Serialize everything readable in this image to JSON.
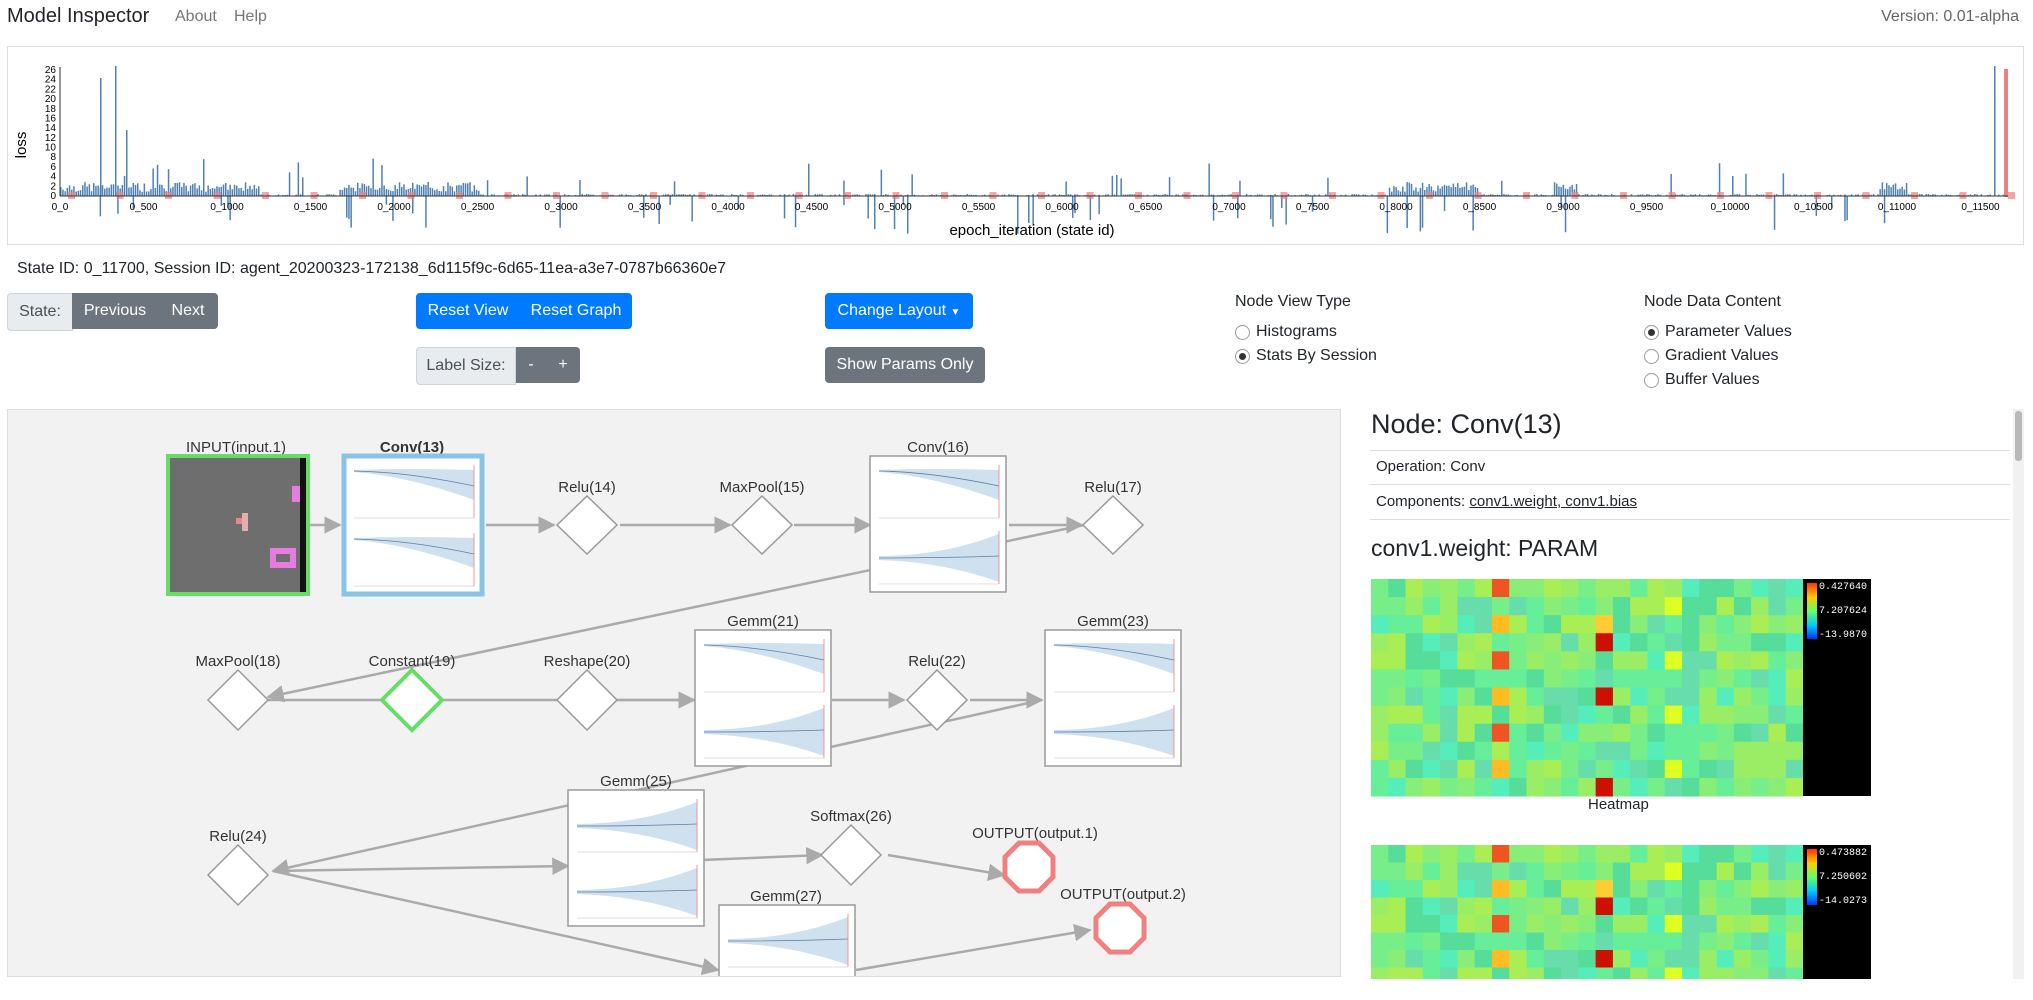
{
  "navbar": {
    "brand": "Model Inspector",
    "links": [
      "About",
      "Help"
    ],
    "version": "Version: 0.01-alpha"
  },
  "loss_chart": {
    "ylabel": "loss",
    "xlabel": "epoch_iteration (state id)",
    "y_ticks": [
      "26",
      "24",
      "22",
      "20",
      "18",
      "16",
      "14",
      "12",
      "10",
      "8",
      "6",
      "4",
      "2",
      "0"
    ],
    "x_ticks": [
      "0_0",
      "0_500",
      "0_1000",
      "0_1500",
      "0_2000",
      "0_2500",
      "0_3000",
      "0_3500",
      "0_4000",
      "0_4500",
      "0_5000",
      "0_5500",
      "0_6000",
      "0_6500",
      "0_7000",
      "0_7500",
      "0_8000",
      "0_8500",
      "0_9000",
      "0_9500",
      "0_10000",
      "0_10500",
      "0_11000",
      "0_11500"
    ],
    "bar_color": "#4f81b4",
    "marker_color": "#f08080"
  },
  "state_info": "State ID: 0_11700, Session ID: agent_20200323-172138_6d115f9c-6d65-11ea-a3e7-0787b66360e7",
  "controls": {
    "state_label": "State:",
    "previous": "Previous",
    "next": "Next",
    "reset_view": "Reset View",
    "reset_graph": "Reset Graph",
    "label_size": "Label Size:",
    "minus": "-",
    "plus": "+",
    "change_layout": "Change Layout",
    "show_params": "Show Params Only"
  },
  "node_view": {
    "title": "Node View Type",
    "options": [
      {
        "label": "Histograms",
        "selected": false
      },
      {
        "label": "Stats By Session",
        "selected": true
      }
    ]
  },
  "node_data": {
    "title": "Node Data Content",
    "options": [
      {
        "label": "Parameter Values",
        "selected": true
      },
      {
        "label": "Gradient Values",
        "selected": false
      },
      {
        "label": "Buffer Values",
        "selected": false
      }
    ]
  },
  "graph": {
    "nodes": {
      "input": "INPUT(input.1)",
      "conv13": "Conv(13)",
      "relu14": "Relu(14)",
      "maxpool15": "MaxPool(15)",
      "conv16": "Conv(16)",
      "relu17": "Relu(17)",
      "maxpool18": "MaxPool(18)",
      "constant19": "Constant(19)",
      "reshape20": "Reshape(20)",
      "gemm21": "Gemm(21)",
      "relu22": "Relu(22)",
      "gemm23": "Gemm(23)",
      "relu24": "Relu(24)",
      "gemm25": "Gemm(25)",
      "softmax26": "Softmax(26)",
      "output1": "OUTPUT(output.1)",
      "gemm27": "Gemm(27)",
      "output2": "OUTPUT(output.2)"
    },
    "colors": {
      "selected": "#87c4e8",
      "active": "#66dd66",
      "output": "#f08080",
      "edge": "#aaaaaa"
    }
  },
  "panel": {
    "title": "Node: Conv(13)",
    "operation": "Operation: Conv",
    "components_label": "Components: ",
    "components_value": "conv1.weight, conv1.bias",
    "param_title": "conv1.weight: PARAM",
    "heatmap_label": "Heatmap",
    "heatmap1_scale": [
      "0.427640",
      "7.207624",
      "-13.9870"
    ],
    "heatmap2_scale": [
      "0.473882",
      "7.250602",
      "-14.0273"
    ]
  }
}
